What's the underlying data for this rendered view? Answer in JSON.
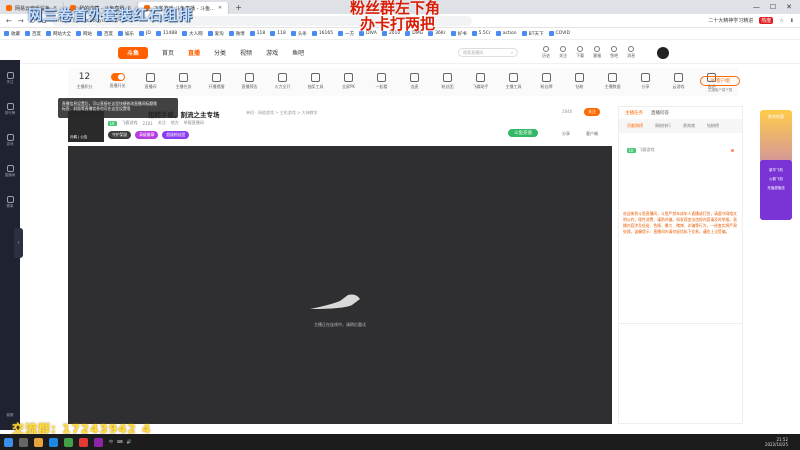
{
  "browser": {
    "tabs": [
      {
        "label": "网易云音乐鲨鱼"
      },
      {
        "label": "我的收藏 - 斗鱼直播"
      },
      {
        "label": "飞客游戏 斗鱼直播 - 斗鱼…",
        "active": true
      }
    ],
    "url": "https://www.douyu.com/",
    "right_tools": [
      "二十大精神学习精进",
      "热度",
      "☆",
      "⬇"
    ],
    "bookmarks": [
      "收藏",
      "百度",
      "网站大全",
      "网站",
      "百度",
      "娱乐",
      "JD",
      "11488",
      "大人网",
      "爱淘",
      "微博",
      "118",
      "118",
      "头条",
      "16165",
      "一方",
      "DIVA",
      "2010",
      "DMG",
      "36Kr",
      "好书",
      "5.5Cr",
      "action",
      "BT天下",
      "COVID"
    ]
  },
  "overlays": {
    "top_left": "网三卷首外套装红石组排",
    "top_center_line1": "粉丝群左下角",
    "top_center_line2": "办卡打两把",
    "bottom_left": "交流群: 17243942 4"
  },
  "left_sidebar": {
    "items": [
      "关注",
      "排行榜",
      "游戏",
      "直播间",
      "赛事"
    ],
    "bottom": "客服"
  },
  "header": {
    "logo": "斗鱼",
    "nav": [
      "首页",
      "直播",
      "分类",
      "视频",
      "游戏",
      "鱼吧"
    ],
    "search_placeholder": "搜索直播间",
    "icons": [
      "历史",
      "关注",
      "下载",
      "客服",
      "鱼吧",
      "消息"
    ]
  },
  "toolbar": {
    "first_number": "12",
    "first_label": "主播积分",
    "items": [
      "直播开关",
      "直播间",
      "主播任务",
      "开播提醒",
      "直播预告",
      "火力全开",
      "抽奖工具",
      "全屏PK",
      "一起看",
      "连麦",
      "粉丝团",
      "飞碟助手",
      "主播工具",
      "粉丝牌",
      "钻粉",
      "主播数据",
      "分享",
      "云游戏",
      "鱼吧",
      "更多"
    ],
    "pc_client": "PC客户端",
    "pc_client_sub": "主播客户端下载"
  },
  "tooltip": {
    "line1": "直播信息设置后，可以直接在这里快捷修改直播间标题哦",
    "line2": "标签、封面等直播信息也可在这里设置哦"
  },
  "room": {
    "avatar_label": "孙鹅 | 公告",
    "title": "粗糙手感，割流之主专场",
    "category": "单机 · 网络游戏 > 主机游戏 > 大神教学",
    "meta": [
      "飞客游戏",
      "2101",
      "关注",
      "地方",
      "举报直播间"
    ],
    "level_tag": "LV",
    "tags": [
      "守护奖励",
      "高级徽章",
      "超级粉丝团"
    ],
    "heat": "2846",
    "follow": "关注",
    "gift_button": "斗鱼充值",
    "action1": "分享",
    "action2": "客户端"
  },
  "player": {
    "loading_text": "主播正在连线中，请稍后重试"
  },
  "chat": {
    "tabs": [
      "主播任务",
      "直播问答"
    ],
    "subtabs": [
      "贡献周榜",
      "周粉排行",
      "贵宾席",
      "钻粉榜"
    ],
    "message_user": "LV",
    "message_text": "飞客游戏",
    "notice": "欢迎来到斗鱼直播间，斗鱼严禁未成年人直播或打赏，请遵守网络文明公约，理性消费，谨防诈骗。如发现违法违规内容请及时举报。直播内容涉及低俗、色情、暴力、赌博、诈骗等行为，一经查实将严肃处理。温馨提示：直播间内请勿轻信私下交易，谨防上当受骗。"
  },
  "float_ad": {
    "top": "首充钜惠",
    "line1": "豪华飞机",
    "line2": "火箭飞机",
    "line3": "充值超值送"
  },
  "taskbar": {
    "time": "21:52",
    "date": "2022/10/25",
    "sys": [
      "中",
      "⌨",
      "🔊"
    ]
  }
}
